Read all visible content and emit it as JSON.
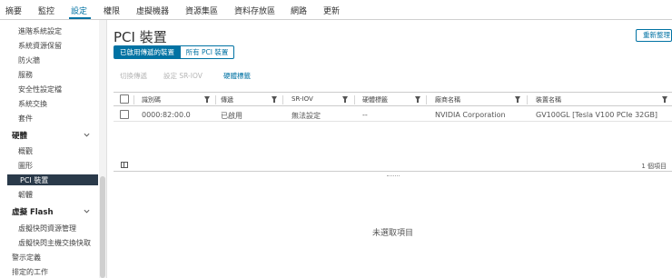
{
  "topnav": {
    "tabs": [
      {
        "label": "摘要",
        "active": false
      },
      {
        "label": "監控",
        "active": false
      },
      {
        "label": "設定",
        "active": true
      },
      {
        "label": "權限",
        "active": false
      },
      {
        "label": "虛擬機器",
        "active": false
      },
      {
        "label": "資源集區",
        "active": false
      },
      {
        "label": "資料存放區",
        "active": false
      },
      {
        "label": "網路",
        "active": false
      },
      {
        "label": "更新",
        "active": false
      }
    ]
  },
  "sidebar": {
    "items": [
      {
        "label": "進階系統設定",
        "type": "item"
      },
      {
        "label": "系統資源保留",
        "type": "item"
      },
      {
        "label": "防火牆",
        "type": "item"
      },
      {
        "label": "服務",
        "type": "item"
      },
      {
        "label": "安全性設定檔",
        "type": "item"
      },
      {
        "label": "系統交換",
        "type": "item"
      },
      {
        "label": "套件",
        "type": "item"
      },
      {
        "label": "硬體",
        "type": "group"
      },
      {
        "label": "概觀",
        "type": "item"
      },
      {
        "label": "圖形",
        "type": "item"
      },
      {
        "label": "PCI 裝置",
        "type": "item",
        "selected": true
      },
      {
        "label": "韌體",
        "type": "item"
      },
      {
        "label": "虛擬 Flash",
        "type": "group"
      },
      {
        "label": "虛擬快閃資源管理",
        "type": "item"
      },
      {
        "label": "虛擬快閃主機交換快取",
        "type": "item"
      },
      {
        "label": "警示定義",
        "type": "item"
      },
      {
        "label": "排定的工作",
        "type": "item"
      }
    ]
  },
  "main": {
    "title": "PCI 裝置",
    "refresh_label": "重新整理",
    "segments": {
      "passthrough": "已啟用傳遞的裝置",
      "all": "所有 PCI 裝置"
    },
    "actions": {
      "toggle": "切換傳遞",
      "sriov": "設定 SR-IOV",
      "hw_label": "硬體標籤"
    }
  },
  "grid": {
    "columns": [
      "識別碼",
      "傳遞",
      "SR-IOV",
      "硬體標籤",
      "廠商名稱",
      "裝置名稱"
    ],
    "rows": [
      {
        "id": "0000:82:00.0",
        "passthrough": "已啟用",
        "sriov": "無法設定",
        "hw_label": "--",
        "vendor": "NVIDIA Corporation",
        "device": "GV100GL [Tesla V100 PCIe 32GB]"
      }
    ],
    "count_label": "1 個項目"
  },
  "details": {
    "empty_label": "未選取項目"
  },
  "colors": {
    "accent": "#0072a3",
    "selected_bg": "#2a3a4a"
  }
}
